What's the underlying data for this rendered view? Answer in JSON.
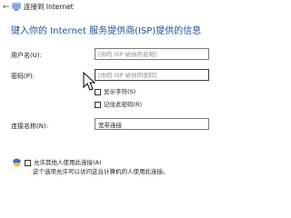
{
  "window": {
    "title": "连接到 Internet"
  },
  "heading": "键入你的 Internet 服务提供商(ISP)提供的信息",
  "form": {
    "username_label": "用户名(U):",
    "username_placeholder": "[你的 ISP 给你的名称]",
    "password_label": "密码(P):",
    "password_placeholder": "[你的 ISP 给你的密码]",
    "show_chars_label": "显示字符(S)",
    "remember_password_label": "记住此密码(R)",
    "connection_name_label": "连接名称(N):",
    "connection_name_value": "宽带连接"
  },
  "sharing": {
    "allow_label": "允许其他人使用此连接(A)",
    "note": "这个选项允许可以访问这台计算机的人使用此连接。"
  },
  "colors": {
    "heading": "#1f4e9c",
    "shield_blue": "#2f6fd6",
    "shield_yellow": "#f2c230"
  },
  "icons": {
    "back": "back-arrow-icon",
    "network": "network-icon",
    "shield": "shield-icon",
    "cursor": "mouse-cursor-icon"
  }
}
